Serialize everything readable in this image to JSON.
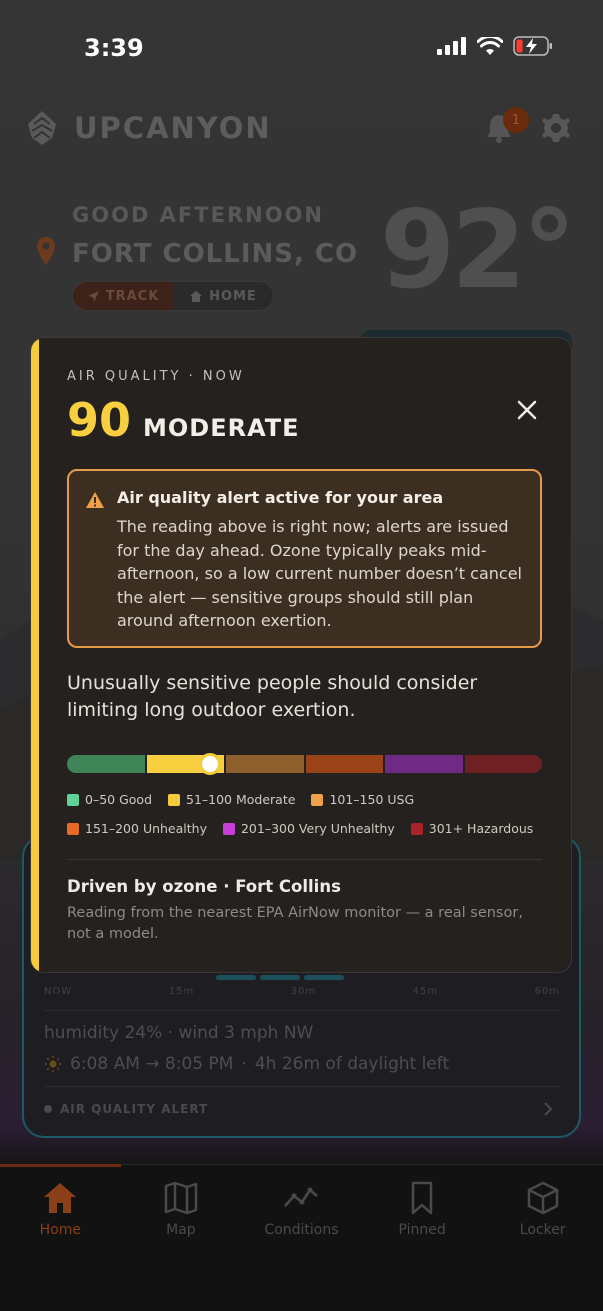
{
  "status_bar": {
    "time": "3:39"
  },
  "header": {
    "brand": "UPCANYON",
    "notification_count": "1"
  },
  "location": {
    "greeting": "GOOD AFTERNOON",
    "city": "FORT COLLINS, CO",
    "temperature": "92°",
    "modes": [
      {
        "label": "TRACK"
      },
      {
        "label": "HOME"
      }
    ]
  },
  "conditions_card": {
    "timeline_ticks": [
      "NOW",
      "15m",
      "30m",
      "45m",
      "60m"
    ],
    "meta": "humidity 24% · wind 3 mph NW",
    "sun": "6:08 AM → 8:05 PM",
    "daylight": "4h 26m of daylight left",
    "alert_label": "AIR QUALITY ALERT"
  },
  "modal": {
    "kicker": "AIR QUALITY · NOW",
    "aqi_value": "90",
    "aqi_category": "MODERATE",
    "aqi_numeric": 90,
    "alert": {
      "title": "Air quality alert active for your area",
      "body": "The reading above is right now; alerts are issued for the day ahead. Ozone typically peaks mid-afternoon, so a low current number doesn’t cancel the alert — sensitive groups should still plan around afternoon exertion."
    },
    "advice": "Unusually sensitive people should consider limiting long outdoor exertion.",
    "scale_segment_colors": [
      "#3f8557",
      "#f8cf3e",
      "#8e5f2c",
      "#9b4318",
      "#6e2a84",
      "#6f2022"
    ],
    "scale_max": 300,
    "legend": [
      {
        "label": "0–50 Good",
        "color": "#5fd19a"
      },
      {
        "label": "51–100 Moderate",
        "color": "#f5cb3c"
      },
      {
        "label": "101–150 USG",
        "color": "#f0a149"
      },
      {
        "label": "151–200 Unhealthy",
        "color": "#e86a26"
      },
      {
        "label": "201–300 Very Unhealthy",
        "color": "#c63ed6"
      },
      {
        "label": "301+ Hazardous",
        "color": "#a8242a"
      }
    ],
    "source_title": "Driven by ozone · Fort Collins",
    "source_body": "Reading from the nearest EPA AirNow monitor — a real sensor, not a model."
  },
  "tabs": [
    {
      "label": "Home",
      "icon": "home-icon",
      "active": true
    },
    {
      "label": "Map",
      "icon": "map-icon",
      "active": false
    },
    {
      "label": "Conditions",
      "icon": "conditions-icon",
      "active": false
    },
    {
      "label": "Pinned",
      "icon": "bookmark-icon",
      "active": false
    },
    {
      "label": "Locker",
      "icon": "cube-icon",
      "active": false
    }
  ],
  "colors": {
    "accent": "#f5cb3c",
    "alert_border": "#e49a48",
    "active_tab": "#8a3f17"
  }
}
